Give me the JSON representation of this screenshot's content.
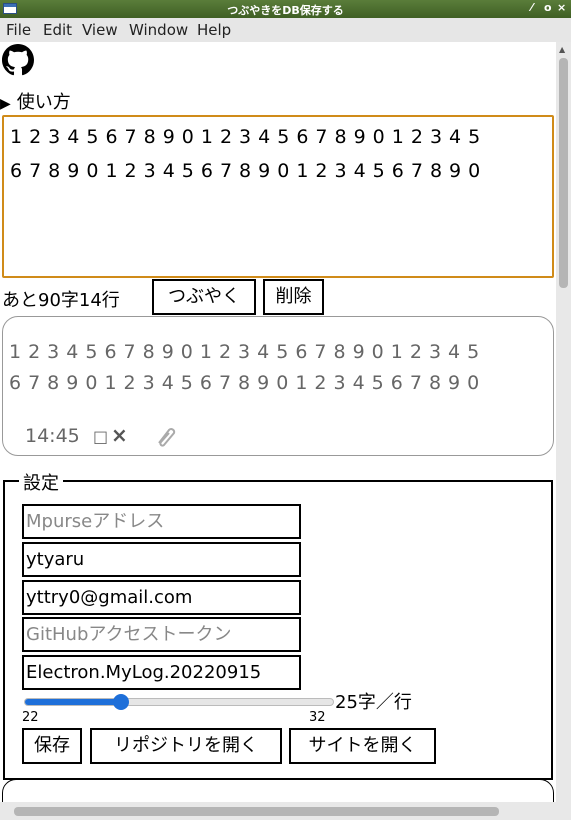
{
  "window": {
    "title": "つぶやきをDB保存する",
    "controls": [
      "⁄",
      "o",
      "×"
    ]
  },
  "menu": [
    "File",
    "Edit",
    "Window",
    "Help"
  ],
  "menu_view": "View",
  "summary_label": "使い方",
  "textarea_value": "1234567890123456789012345\n6789012345678901234567890",
  "char_count": "あと90字14行",
  "buttons": {
    "tweet": "つぶやく",
    "delete": "削除",
    "save": "保存",
    "open_repo": "リポジトリを開く",
    "open_site": "サイトを開く"
  },
  "post": {
    "text": "1234567890123456789012345\n6789012345678901234567890",
    "time": "14:45",
    "checkbox": "□",
    "delete_mark": "×"
  },
  "settings": {
    "legend": "設定",
    "mpurse_placeholder": "Mpurseアドレス",
    "username": "ytyaru",
    "email": "yttry0@gmail.com",
    "token_placeholder": "GitHubアクセストークン",
    "repo": "Electron.MyLog.20220915",
    "slider": {
      "min": "22",
      "max": "32",
      "value": 25,
      "unit_label": "25字／行"
    }
  }
}
